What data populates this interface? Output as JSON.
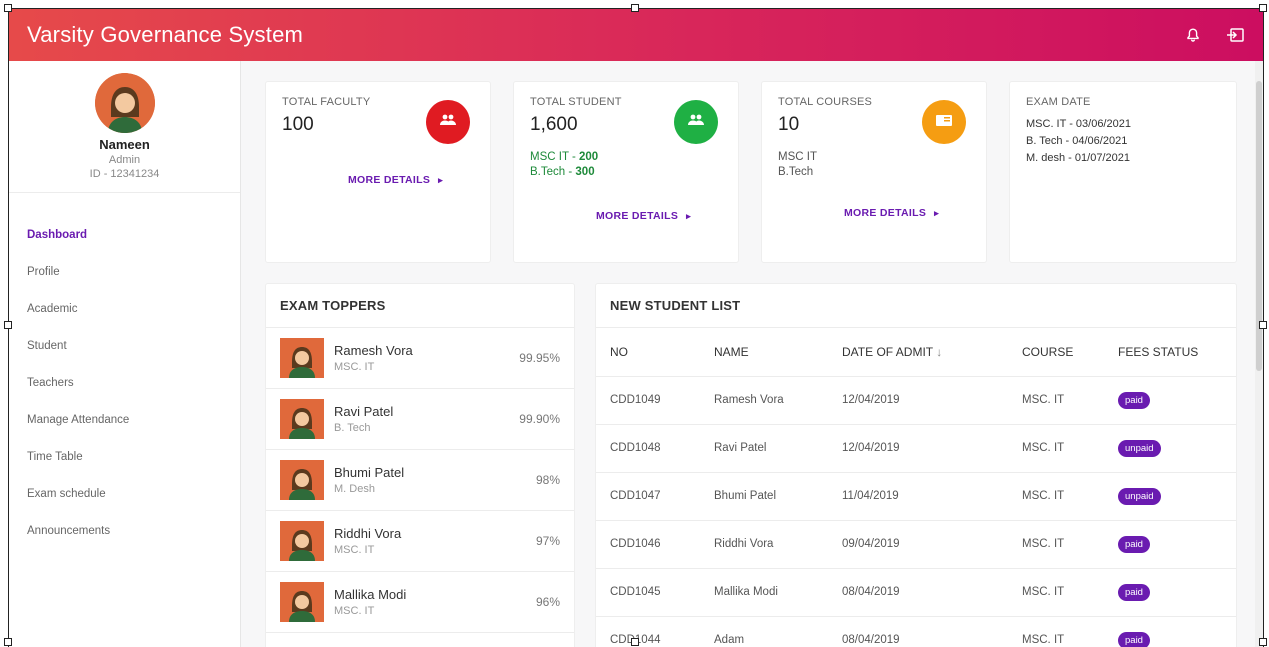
{
  "app": {
    "title": "Varsity Governance System"
  },
  "header_icons": {
    "notification": "bell-icon",
    "logout": "logout-icon"
  },
  "profile": {
    "name": "Nameen",
    "role": "Admin",
    "id": "ID - 12341234"
  },
  "sidebar": {
    "items": [
      {
        "label": "Dashboard",
        "active": true
      },
      {
        "label": "Profile"
      },
      {
        "label": "Academic"
      },
      {
        "label": "Student"
      },
      {
        "label": "Teachers"
      },
      {
        "label": "Manage Attendance"
      },
      {
        "label": "Time Table"
      },
      {
        "label": "Exam schedule"
      },
      {
        "label": "Announcements"
      }
    ]
  },
  "stats": {
    "faculty": {
      "label": "TOTAL FACULTY",
      "value": "100",
      "icon": "group-icon",
      "color": "#e01b22",
      "more": "MORE DETAILS"
    },
    "student": {
      "label": "TOTAL STUDENT",
      "value": "1,600",
      "icon": "group-icon",
      "color": "#1fb044",
      "lines": [
        {
          "name": "MSC IT",
          "sep": " - ",
          "count": "200"
        },
        {
          "name": "B.Tech",
          "sep": " - ",
          "count": "300"
        }
      ],
      "more": "MORE DETAILS"
    },
    "courses": {
      "label": "TOTAL COURSES",
      "value": "10",
      "icon": "book-icon",
      "color": "#f59d12",
      "lines": [
        "MSC IT",
        "B.Tech"
      ],
      "more": "MORE DETAILS"
    },
    "exam": {
      "label": "EXAM DATE",
      "lines": [
        "MSC. IT - 03/06/2021",
        "B. Tech - 04/06/2021",
        "M. desh - 01/07/2021"
      ]
    }
  },
  "toppers": {
    "title": "EXAM TOPPERS",
    "items": [
      {
        "name": "Ramesh Vora",
        "course": "MSC. IT",
        "score": "99.95%"
      },
      {
        "name": "Ravi Patel",
        "course": "B. Tech",
        "score": "99.90%"
      },
      {
        "name": "Bhumi Patel",
        "course": "M. Desh",
        "score": "98%"
      },
      {
        "name": "Riddhi Vora",
        "course": "MSC. IT",
        "score": "97%"
      },
      {
        "name": "Mallika Modi",
        "course": "MSC. IT",
        "score": "96%"
      }
    ]
  },
  "students": {
    "title": "NEW STUDENT LIST",
    "columns": [
      "NO",
      "NAME",
      "DATE OF ADMIT",
      "COURSE",
      "FEES STATUS"
    ],
    "rows": [
      {
        "no": "CDD1049",
        "name": "Ramesh Vora",
        "date": "12/04/2019",
        "course": "MSC. IT",
        "status": "paid"
      },
      {
        "no": "CDD1048",
        "name": "Ravi Patel",
        "date": "12/04/2019",
        "course": "MSC. IT",
        "status": "unpaid"
      },
      {
        "no": "CDD1047",
        "name": "Bhumi Patel",
        "date": "11/04/2019",
        "course": "MSC. IT",
        "status": "unpaid"
      },
      {
        "no": "CDD1046",
        "name": "Riddhi Vora",
        "date": "09/04/2019",
        "course": "MSC. IT",
        "status": "paid"
      },
      {
        "no": "CDD1045",
        "name": "Mallika Modi",
        "date": "08/04/2019",
        "course": "MSC. IT",
        "status": "paid"
      },
      {
        "no": "CDD1044",
        "name": "Adam",
        "date": "08/04/2019",
        "course": "MSC. IT",
        "status": "paid"
      }
    ]
  }
}
